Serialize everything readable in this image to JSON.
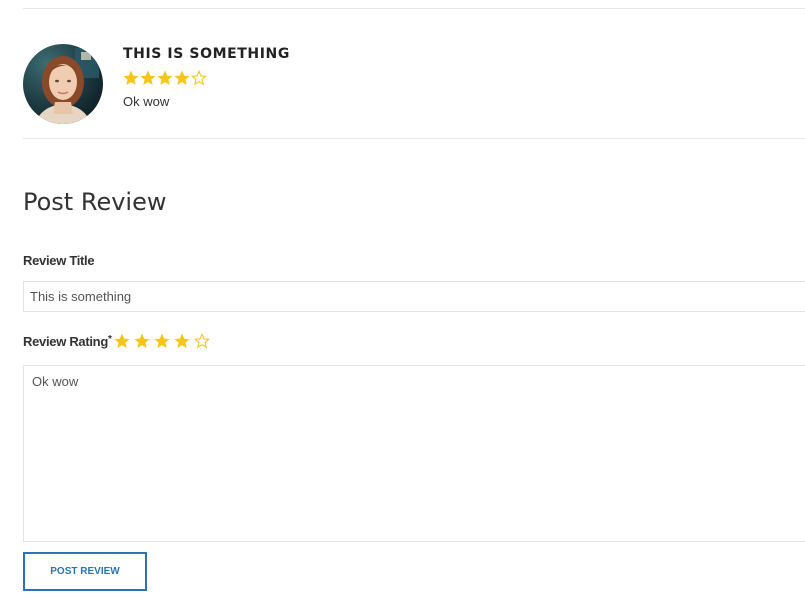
{
  "existing_review": {
    "title": "THIS IS SOMETHING",
    "rating": 4,
    "max_rating": 5,
    "text": "Ok wow",
    "avatar_icon": "user-avatar-photo"
  },
  "post_review": {
    "heading": "Post Review",
    "title_label": "Review Title",
    "title_value": "This is something",
    "rating_label": "Review Rating",
    "rating_required_mark": "*",
    "rating": 4,
    "max_rating": 5,
    "text_value": "Ok wow",
    "submit_label": "POST REVIEW"
  },
  "colors": {
    "star_filled": "#f5c518",
    "star_outline": "#f5c518",
    "button_accent": "#2a73b8",
    "divider": "#e6e6e6"
  }
}
